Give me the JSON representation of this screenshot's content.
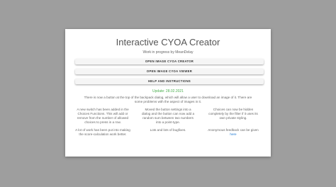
{
  "app": {
    "title": "Interactive CYOA Creator",
    "subtitle": "Work in progress by MeanDelay"
  },
  "buttons": {
    "creator": "Open Image CYOA Creator",
    "viewer": "Open Image CYOA Viewer",
    "help": "Help and instructions"
  },
  "update": {
    "date": "Update: 28.02.2021",
    "notice": "There is now a button at the top of the backpack dialog, which will allow a user to download an image of it. There are some problems with the aspect of images in it."
  },
  "features": [
    "A new switch has been added in the Choices Functions. This will add or remove from the number of allowed choices to press in a row.",
    "Moved the button settings into a dialog and the button can now add a random sum between two numbers into a point-type.",
    "Choices can now be hidden completely by the filter if it uses its own private styling.",
    "A lot of work has been put into making the score-calculation work better.",
    "Lots and lots of bugfixes.",
    "Anonymous feedback can be given"
  ],
  "feedback_link": "here",
  "colors": {
    "background": "#9e9e9e",
    "card": "#ffffff",
    "update": "#4caf50",
    "link": "#1976d2"
  }
}
